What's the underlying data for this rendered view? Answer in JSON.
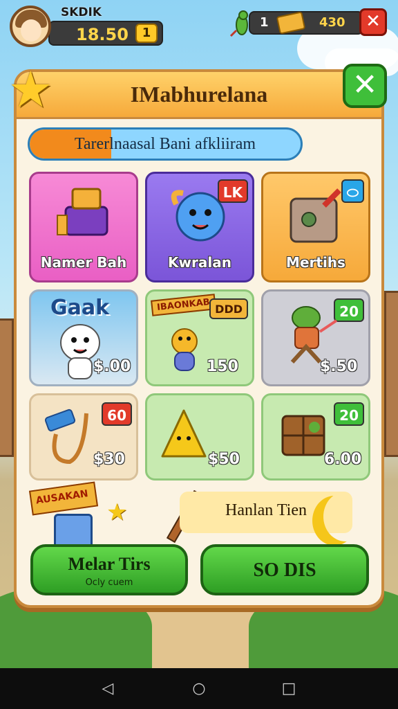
{
  "hud": {
    "player_name": "SKDIK",
    "score": "18.50",
    "score_badge": "1",
    "resource_count": "1",
    "resource_value": "430",
    "gecko_icon": "gecko-icon",
    "ticket_icon": "ticket-icon",
    "close_label": "✕"
  },
  "panel": {
    "title": "IMabhurelana",
    "close_label": "✕",
    "progress_text": "Tarerlnaasal  Bani afkliiram",
    "progress_fraction": 0.3
  },
  "cards": [
    {
      "label": "Namer Bah",
      "color": "#e95fc4"
    },
    {
      "label": "Kwralan",
      "badge": "LK",
      "color": "#7b55d8"
    },
    {
      "label": "Mertihs",
      "badge": "⬭",
      "color": "#f6a93a"
    }
  ],
  "items": [
    {
      "heading": "Gaak",
      "price": "$.00"
    },
    {
      "heading": "IBAONKAB",
      "tag": "DDD",
      "price": "150"
    },
    {
      "tag": "20",
      "price": "$.50"
    },
    {
      "tag": "60",
      "price": "$30"
    },
    {
      "price": "$50"
    },
    {
      "tag": "20",
      "price": "6.00"
    }
  ],
  "bottom": {
    "sign_text": "AUSAKAN",
    "banner_text": "Hanlan Tien",
    "left_button": "Melar Tirs",
    "left_button_sub": "Ocly cuem",
    "right_button": "SO DIS"
  },
  "nav": {
    "back": "◁",
    "home": "○",
    "recents": "□"
  },
  "colors": {
    "accent": "#f6a93a",
    "button_green": "#3fbf3a",
    "danger": "#e23a2a"
  }
}
